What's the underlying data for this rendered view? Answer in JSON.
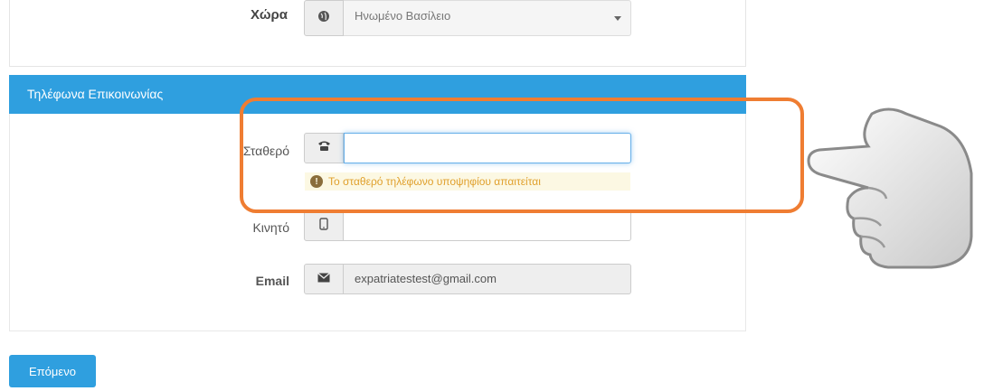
{
  "address": {
    "country_label": "Χώρα",
    "country_value": "Ηνωμένο Βασίλειο",
    "country_icon": "globe-icon"
  },
  "contact": {
    "heading": "Τηλέφωνα Επικοινωνίας",
    "landline_label": "Σταθερό",
    "landline_value": "",
    "landline_icon": "phone-icon",
    "landline_warning": "Το σταθερό τηλέφωνο υποψηφίου απαιτείται",
    "mobile_label": "Κινητό",
    "mobile_value": "",
    "mobile_icon": "mobile-icon",
    "email_label": "Email",
    "email_value": "expatriatestest@gmail.com",
    "email_icon": "envelope-icon"
  },
  "actions": {
    "next_label": "Επόμενο"
  },
  "colors": {
    "accent": "#2f9fdf",
    "highlight": "#ef7d32",
    "warning_bg": "#fcf8e3",
    "warning_text": "#e0a02c"
  }
}
